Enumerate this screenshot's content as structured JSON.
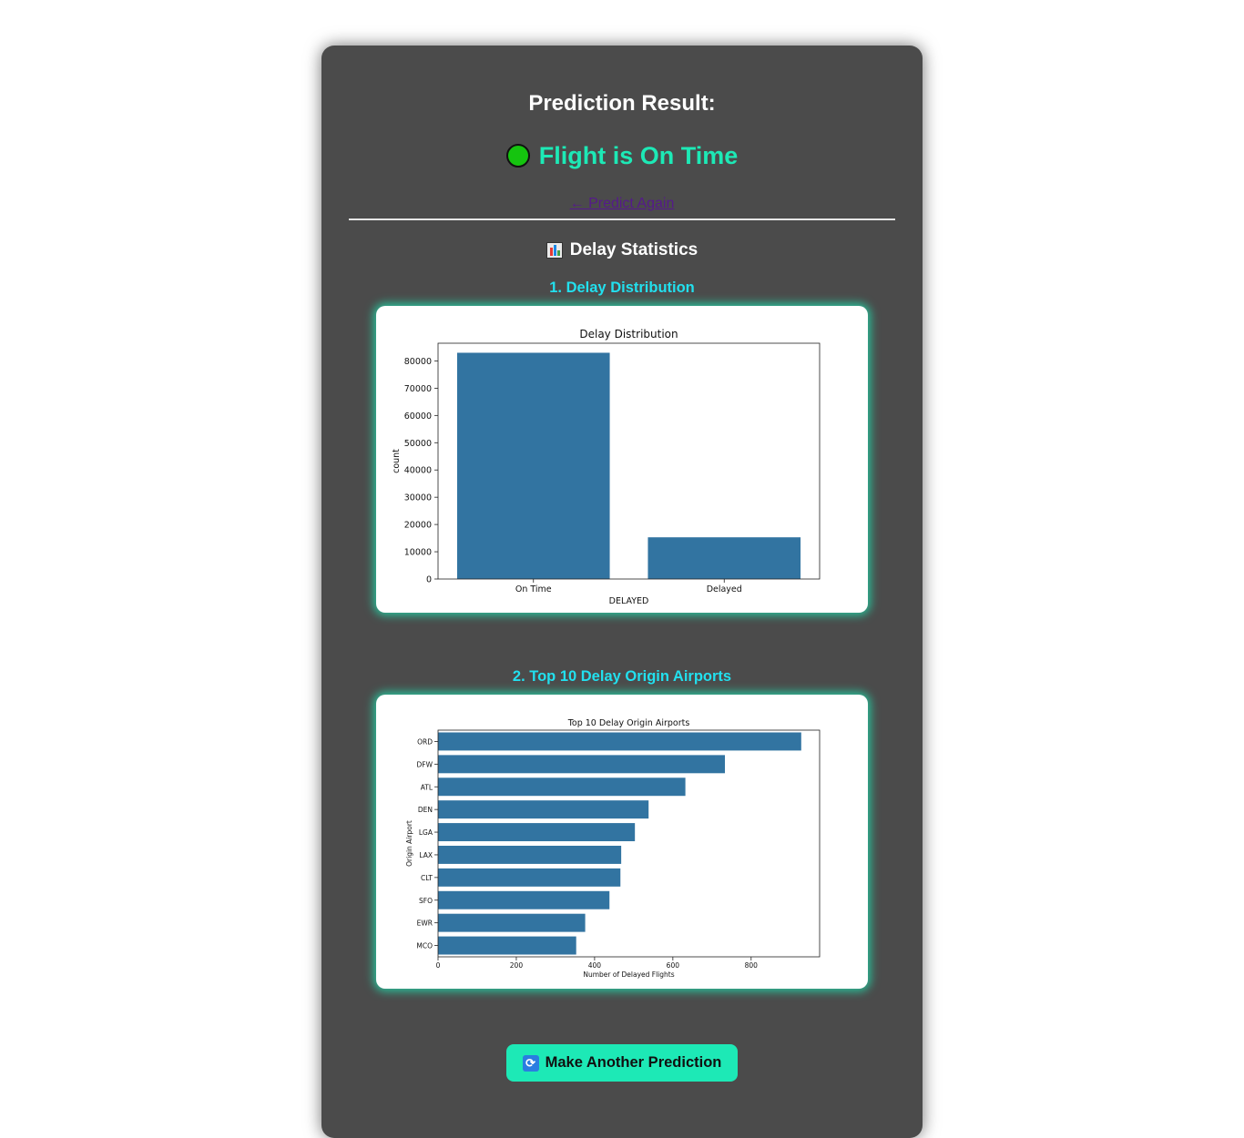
{
  "result": {
    "heading": "Prediction Result:",
    "status_text": "Flight is On Time",
    "status_color": "#15c40f",
    "predict_again": "← Predict Again"
  },
  "stats": {
    "heading": "Delay Statistics",
    "icon": "bar-chart-icon"
  },
  "sections": [
    {
      "heading": "1. Delay Distribution"
    },
    {
      "heading": "2. Top 10 Delay Origin Airports"
    }
  ],
  "cta": {
    "label": "Make Another Prediction",
    "icon": "repeat-icon"
  },
  "colors": {
    "accent": "#1de9b6",
    "section_heading": "#22e0ee",
    "bar": "#3274a1",
    "panel": "#4b4b4b"
  },
  "chart_data": [
    {
      "type": "bar",
      "title": "Delay Distribution",
      "xlabel": "DELAYED",
      "ylabel": "count",
      "categories": [
        "On Time",
        "Delayed"
      ],
      "values": [
        83000,
        15300
      ],
      "ylim": [
        0,
        86500
      ],
      "yticks": [
        0,
        10000,
        20000,
        30000,
        40000,
        50000,
        60000,
        70000,
        80000
      ]
    },
    {
      "type": "bar",
      "orientation": "horizontal",
      "title": "Top 10 Delay Origin Airports",
      "xlabel": "Number of Delayed Flights",
      "ylabel": "Origin Airport",
      "categories": [
        "ORD",
        "DFW",
        "ATL",
        "DEN",
        "LGA",
        "LAX",
        "CLT",
        "SFO",
        "EWR",
        "MCO"
      ],
      "values": [
        928,
        733,
        632,
        538,
        503,
        468,
        466,
        438,
        376,
        353
      ],
      "xlim": [
        0,
        975
      ],
      "xticks": [
        0,
        200,
        400,
        600,
        800
      ]
    }
  ]
}
